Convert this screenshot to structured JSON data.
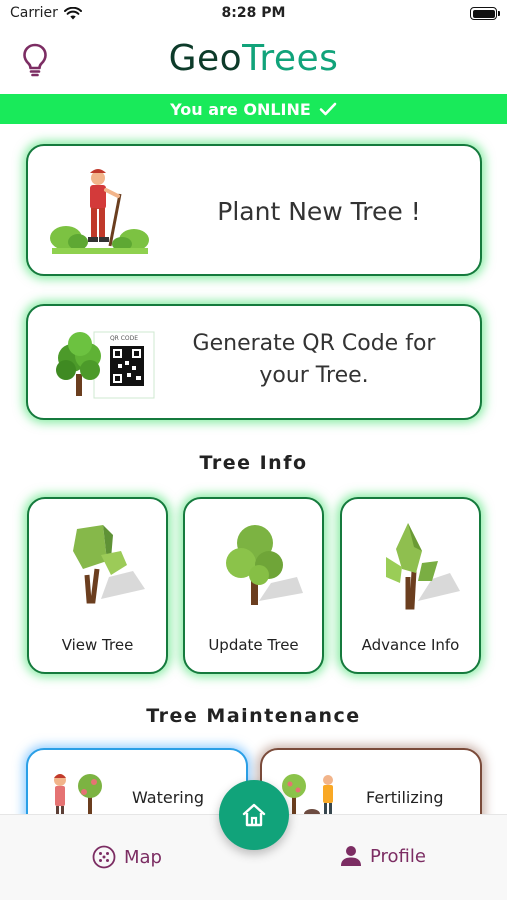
{
  "status_bar": {
    "carrier": "Carrier",
    "time": "8:28 PM"
  },
  "header": {
    "title_part1": "Geo",
    "title_part2": "Trees",
    "hint_icon": "lightbulb-icon"
  },
  "banner": {
    "text": "You are ONLINE",
    "icon": "checkmark-icon",
    "color": "#19ea5a"
  },
  "actions": {
    "plant": {
      "label": "Plant New Tree !"
    },
    "qr": {
      "label_line1": "Generate QR Code for",
      "label_line2": "your Tree.",
      "qr_caption": "QR CODE"
    }
  },
  "tree_info": {
    "title": "Tree Info",
    "items": [
      {
        "label": "View Tree"
      },
      {
        "label": "Update Tree"
      },
      {
        "label": "Advance Info"
      }
    ]
  },
  "maintenance": {
    "title": "Tree Maintenance",
    "items": [
      {
        "label": "Watering",
        "color": "#2b9fe6"
      },
      {
        "label": "Fertilizing",
        "color": "#7a4b3a"
      }
    ]
  },
  "nav": {
    "map_label": "Map",
    "profile_label": "Profile",
    "home_icon": "home-icon"
  },
  "colors": {
    "brand_green": "#11a37a",
    "brand_dark": "#0d3b2a",
    "accent_purple": "#7c2d63",
    "card_border": "#157a3d"
  }
}
